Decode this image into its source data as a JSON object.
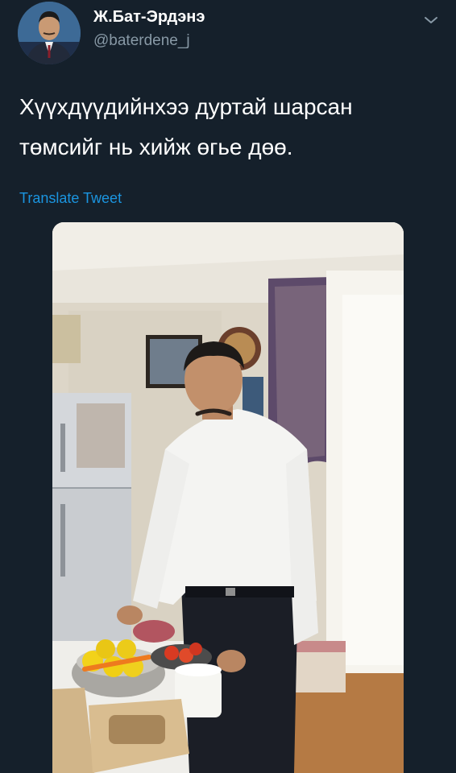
{
  "author": {
    "name": "Ж.Бат-Эрдэнэ",
    "handle": "@baterdene_j",
    "avatar_icon": "user-avatar-photo"
  },
  "tweet": {
    "text_line1": "Хүүхдүүдийнхээ дуртай шарсан",
    "text_line2": "төмсийг нь хийж өгье дөө.",
    "translate_label": "Translate Tweet"
  },
  "menu": {
    "icon": "chevron-down-icon"
  },
  "media": {
    "subject": "man-in-white-shirt-in-kitchen-photo"
  },
  "colors": {
    "background": "#15202b",
    "text_primary": "#ffffff",
    "text_secondary": "#8899a6",
    "link": "#1b95e0"
  }
}
